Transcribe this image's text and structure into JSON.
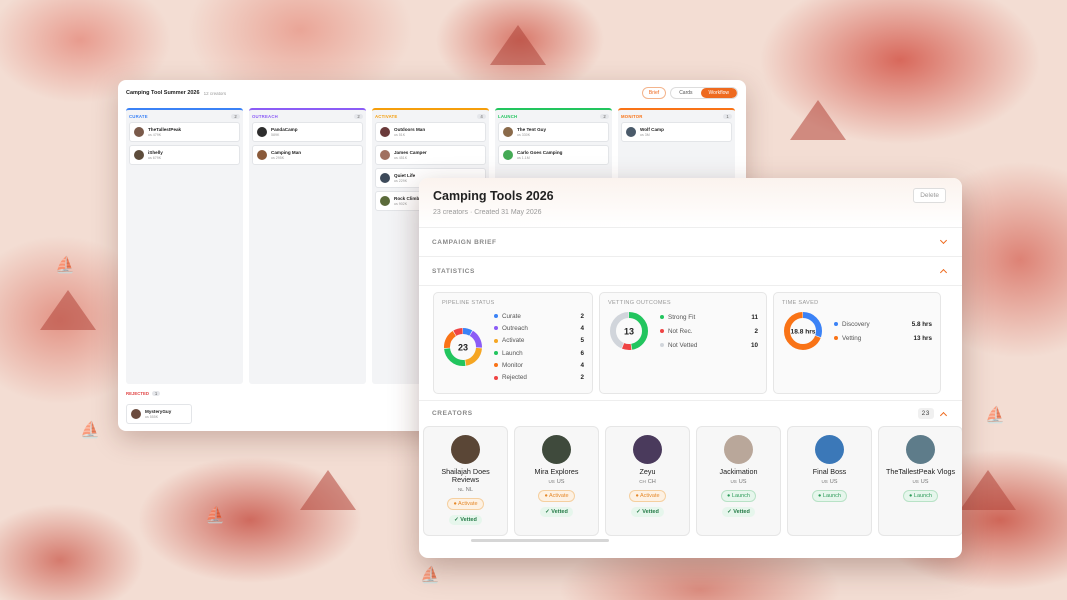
{
  "board": {
    "title": "Camping Tool Summer 2026",
    "count": "12 creators",
    "brief_label": "Brief",
    "view_cards": "Cards",
    "view_workflow": "Workflow",
    "columns": [
      {
        "name": "CURATE",
        "count": "2",
        "color": "#3b82f6",
        "cards": [
          {
            "name": "TheTallestPeak",
            "sub": "us 479K"
          },
          {
            "name": "iShelly",
            "sub": "us 679K"
          }
        ]
      },
      {
        "name": "OUTREACH",
        "count": "2",
        "color": "#8b5cf6",
        "cards": [
          {
            "name": "PandaCamp",
            "sub": "589K"
          },
          {
            "name": "Camping Man",
            "sub": "us 295K"
          }
        ]
      },
      {
        "name": "ACTIVATE",
        "count": "4",
        "color": "#f59e0b",
        "cards": [
          {
            "name": "Outdoors Man",
            "sub": "us 51K"
          },
          {
            "name": "James Camper",
            "sub": "us 451K"
          },
          {
            "name": "Quiet Life",
            "sub": "us 229K"
          },
          {
            "name": "Rock Climb",
            "sub": "us 902K"
          }
        ]
      },
      {
        "name": "LAUNCH",
        "count": "2",
        "color": "#22c55e",
        "cards": [
          {
            "name": "The Tent Guy",
            "sub": "us 330K"
          },
          {
            "name": "Carlo Goes Camping",
            "sub": "us 1.1M"
          }
        ]
      },
      {
        "name": "MONITOR",
        "count": "1",
        "color": "#f97316",
        "cards": [
          {
            "name": "Wolf Camp",
            "sub": "us 3M"
          }
        ]
      }
    ],
    "rejected": {
      "label": "REJECTED",
      "count": "1",
      "card": {
        "name": "MysteryGuy",
        "sub": "us 555K"
      }
    }
  },
  "campaign": {
    "title": "Camping Tools 2026",
    "subtitle": "23 creators · Created 31 May 2026",
    "delete_label": "Delete",
    "sections": {
      "brief": "CAMPAIGN BRIEF",
      "statistics": "STATISTICS",
      "creators": "CREATORS"
    },
    "creators_count": "23"
  },
  "stats": {
    "pipeline": {
      "title": "PIPELINE STATUS",
      "total": "23",
      "items": [
        {
          "label": "Curate",
          "value": 2,
          "color": "#3b82f6"
        },
        {
          "label": "Outreach",
          "value": 4,
          "color": "#8b5cf6"
        },
        {
          "label": "Activate",
          "value": 5,
          "color": "#f5a623"
        },
        {
          "label": "Launch",
          "value": 6,
          "color": "#22c55e"
        },
        {
          "label": "Monitor",
          "value": 4,
          "color": "#f97316"
        },
        {
          "label": "Rejected",
          "value": 2,
          "color": "#ef4444"
        }
      ]
    },
    "vetting": {
      "title": "VETTING OUTCOMES",
      "total": "13",
      "items": [
        {
          "label": "Strong Fit",
          "value": 11,
          "color": "#22c55e"
        },
        {
          "label": "Not Rec.",
          "value": 2,
          "color": "#ef4444"
        },
        {
          "label": "Not Vetted",
          "value": 10,
          "color": "#d1d5db"
        }
      ]
    },
    "time": {
      "title": "TIME SAVED",
      "total": "18.8 hrs",
      "items": [
        {
          "label": "Discovery",
          "value_text": "5.8 hrs",
          "value": 5.8,
          "color": "#3b82f6"
        },
        {
          "label": "Vetting",
          "value_text": "13 hrs",
          "value": 13,
          "color": "#f97316"
        }
      ]
    }
  },
  "creators": [
    {
      "name": "Shailajah Does Reviews",
      "cc": "NL",
      "country": "NL",
      "stage": "Activate",
      "vetted": "✓ Vetted",
      "avatar": "#5a4636"
    },
    {
      "name": "Mira Explores",
      "cc": "US",
      "country": "US",
      "stage": "Activate",
      "vetted": "✓ Vetted",
      "avatar": "#3f4a3c"
    },
    {
      "name": "Zeyu",
      "cc": "CH",
      "country": "CH",
      "stage": "Activate",
      "vetted": "✓ Vetted",
      "avatar": "#4a3a5c"
    },
    {
      "name": "Jackimation",
      "cc": "US",
      "country": "US",
      "stage": "Launch",
      "vetted": "✓ Vetted",
      "avatar": "#b9a79a"
    },
    {
      "name": "Final Boss",
      "cc": "US",
      "country": "US",
      "stage": "Launch",
      "vetted": "",
      "avatar": "#3b78b8"
    },
    {
      "name": "TheTallestPeak Vlogs",
      "cc": "US",
      "country": "US",
      "stage": "Launch",
      "vetted": "",
      "avatar": "#5e7c8a"
    }
  ]
}
